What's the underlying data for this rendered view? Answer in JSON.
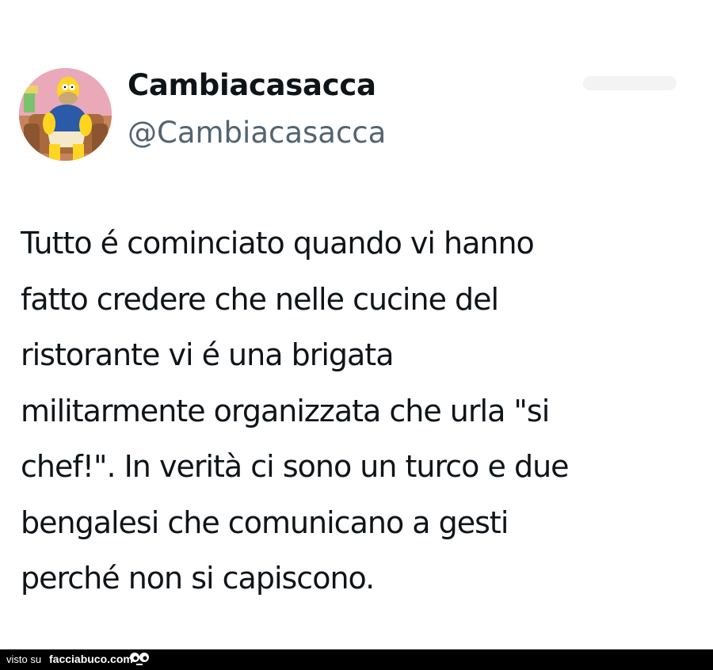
{
  "tweet": {
    "author": {
      "display_name": "Cambiacasacca",
      "handle": "@Cambiacasacca",
      "avatar": "homer-simpson-avatar"
    },
    "text_lines": [
      "Tutto é cominciato quando vi hanno",
      "fatto credere che nelle cucine del",
      "ristorante vi é una brigata",
      "militarmente organizzata che urla \"si",
      "chef!\". In verità ci sono un turco e due",
      "bengalesi che comunicano a gesti",
      "perché non si capiscono."
    ]
  },
  "footer": {
    "prefix": "visto su",
    "site": "facciabuco.com",
    "logo_icon": "eyes-icon"
  },
  "colors": {
    "text": "#0f1419",
    "handle": "#536471",
    "background": "#ffffff",
    "footer_bg": "#000000"
  }
}
